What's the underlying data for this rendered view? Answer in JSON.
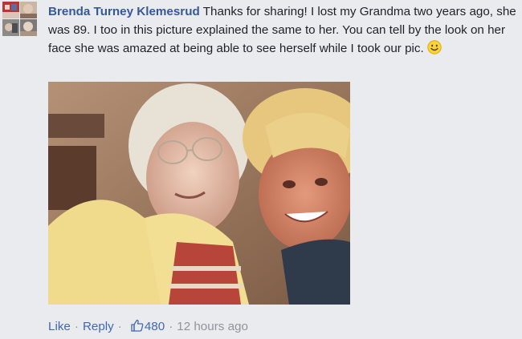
{
  "comment": {
    "author": "Brenda Turney Klemesrud",
    "text": "Thanks for sharing! I lost my Grandma two years ago, she was 89. I too in this picture explained the same to her. You can tell by the look on her face she was amazed at being able to see herself while I took our pic.",
    "emoji_icon": "smiley-emoji-icon",
    "photo_icon": "selfie-photo"
  },
  "actions": {
    "like_label": "Like",
    "reply_label": "Reply",
    "separator": "·",
    "like_count": "480",
    "timestamp": "12 hours ago",
    "like_icon": "thumbs-up-icon"
  },
  "colors": {
    "author": "#365899",
    "link": "#4267b2",
    "muted": "#90949c",
    "background": "#e9ebee"
  }
}
